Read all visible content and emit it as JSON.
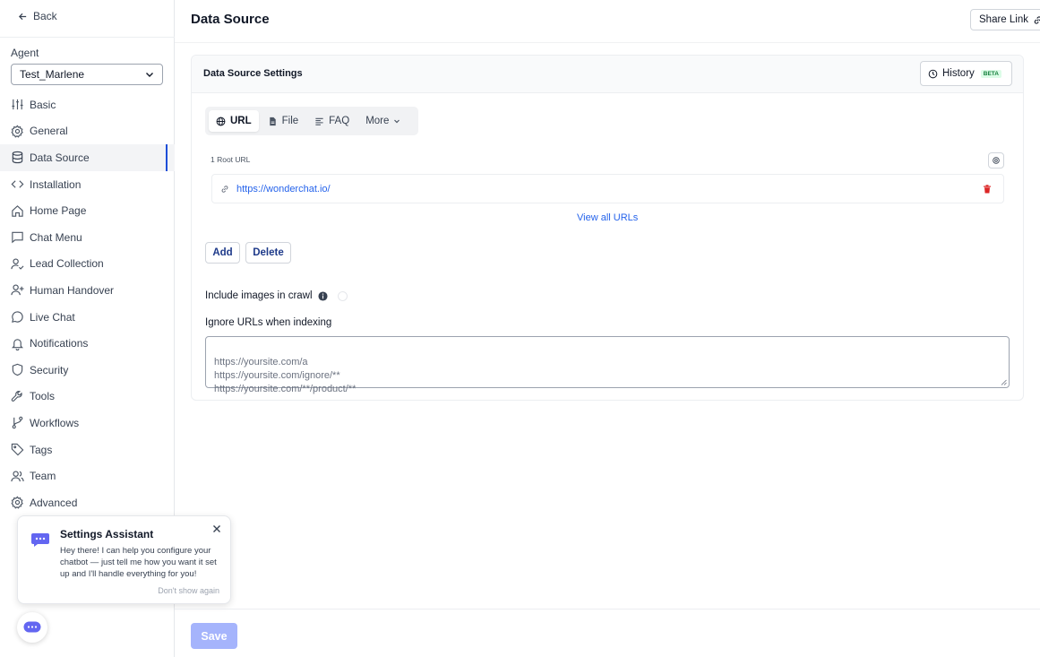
{
  "sidebar": {
    "back_label": "Back",
    "agent_label": "Agent",
    "agent_value": "Test_Marlene",
    "items": [
      {
        "label": "Basic",
        "icon": "sliders-icon"
      },
      {
        "label": "General",
        "icon": "gear-icon"
      },
      {
        "label": "Data Source",
        "icon": "database-icon",
        "active": true
      },
      {
        "label": "Installation",
        "icon": "code-icon"
      },
      {
        "label": "Home Page",
        "icon": "home-icon"
      },
      {
        "label": "Chat Menu",
        "icon": "chat-bubble-icon"
      },
      {
        "label": "Lead Collection",
        "icon": "user-check-icon"
      },
      {
        "label": "Human Handover",
        "icon": "user-plus-icon"
      },
      {
        "label": "Live Chat",
        "icon": "message-circle-icon"
      },
      {
        "label": "Notifications",
        "icon": "bell-icon"
      },
      {
        "label": "Security",
        "icon": "shield-icon"
      },
      {
        "label": "Tools",
        "icon": "wrench-icon"
      },
      {
        "label": "Workflows",
        "icon": "branch-icon"
      },
      {
        "label": "Tags",
        "icon": "tag-icon"
      },
      {
        "label": "Team",
        "icon": "users-icon"
      },
      {
        "label": "Advanced",
        "icon": "gear-icon"
      }
    ]
  },
  "assistant": {
    "title": "Settings Assistant",
    "body": "Hey there! I can help you configure your chatbot — just tell me how you want it set up and I'll handle everything for you!",
    "dont_show": "Don't show again"
  },
  "header": {
    "title": "Data Source",
    "share_label": "Share Link"
  },
  "card": {
    "title": "Data Source Settings",
    "history_label": "History",
    "history_badge": "BETA",
    "tabs": [
      {
        "label": "URL",
        "icon": "globe-icon"
      },
      {
        "label": "File",
        "icon": "file-icon"
      },
      {
        "label": "FAQ",
        "icon": "list-icon"
      },
      {
        "label": "More",
        "icon": "chevron-down-icon"
      }
    ],
    "root_url_label": "1 Root URL",
    "urls": [
      "https://wonderchat.io/"
    ],
    "view_all": "View all URLs",
    "add_label": "Add",
    "delete_label": "Delete",
    "include_images_label": "Include images in crawl",
    "ignore_label": "Ignore URLs when indexing",
    "ignore_placeholder": "https://yoursite.com/a\nhttps://yoursite.com/ignore/**\nhttps://yoursite.com/**/product/**"
  },
  "footer": {
    "save_label": "Save"
  },
  "colors": {
    "accent": "#2563eb",
    "active_indicator": "#1d4ed8",
    "save_disabled": "#a5b4fc",
    "beta_bg": "#dcfce7",
    "danger": "#dc2626"
  }
}
